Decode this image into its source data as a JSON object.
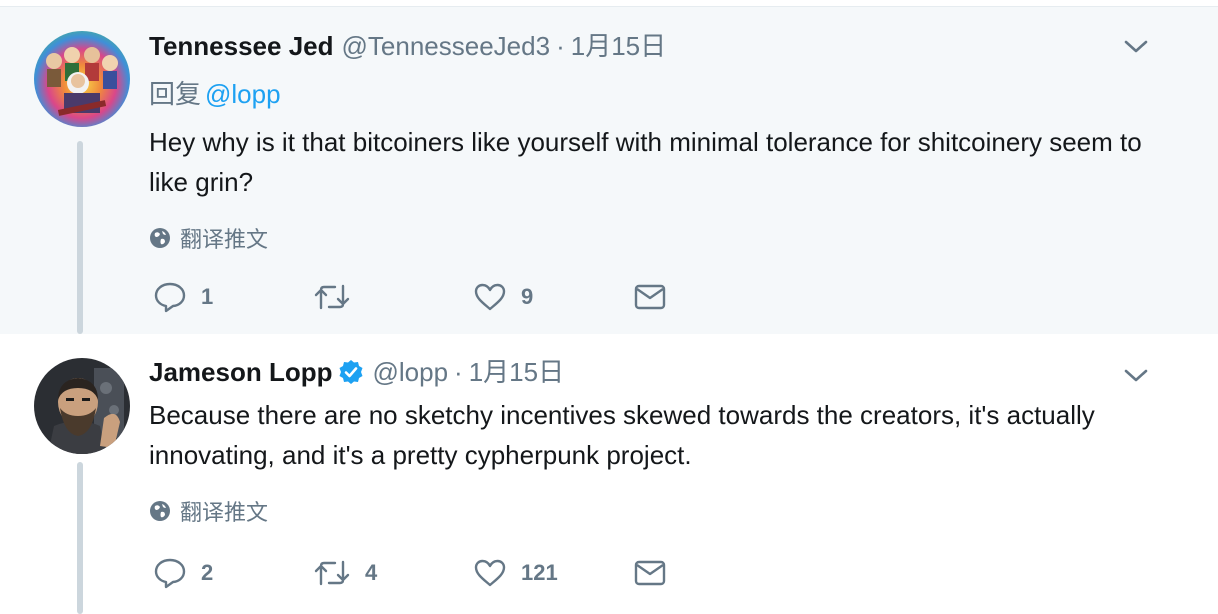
{
  "tweets": [
    {
      "author_name": "Tennessee Jed",
      "handle": "@TennesseeJed3",
      "separator": "·",
      "date": "1月15日",
      "reply_prefix": "回复",
      "reply_mention": "@lopp",
      "text": "Hey why is it that bitcoiners like yourself with minimal tolerance for shitcoinery seem to like grin?",
      "translate_label": "翻译推文",
      "reply_count": "1",
      "retweet_count": "",
      "like_count": "9"
    },
    {
      "author_name": "Jameson Lopp",
      "handle": "@lopp",
      "separator": "·",
      "date": "1月15日",
      "verified": true,
      "text": "Because there are no sketchy incentives skewed towards the creators, it's actually innovating, and it's a pretty cypherpunk project.",
      "translate_label": "翻译推文",
      "reply_count": "2",
      "retweet_count": "4",
      "like_count": "121"
    }
  ],
  "colors": {
    "accent": "#1da1f2",
    "muted": "#657786",
    "thread_line": "#ccd6dd",
    "highlight_bg": "#f5f8fa"
  },
  "icons": [
    "chevron-down-icon",
    "globe-icon",
    "reply-icon",
    "retweet-icon",
    "like-icon",
    "message-icon",
    "verified-icon"
  ]
}
